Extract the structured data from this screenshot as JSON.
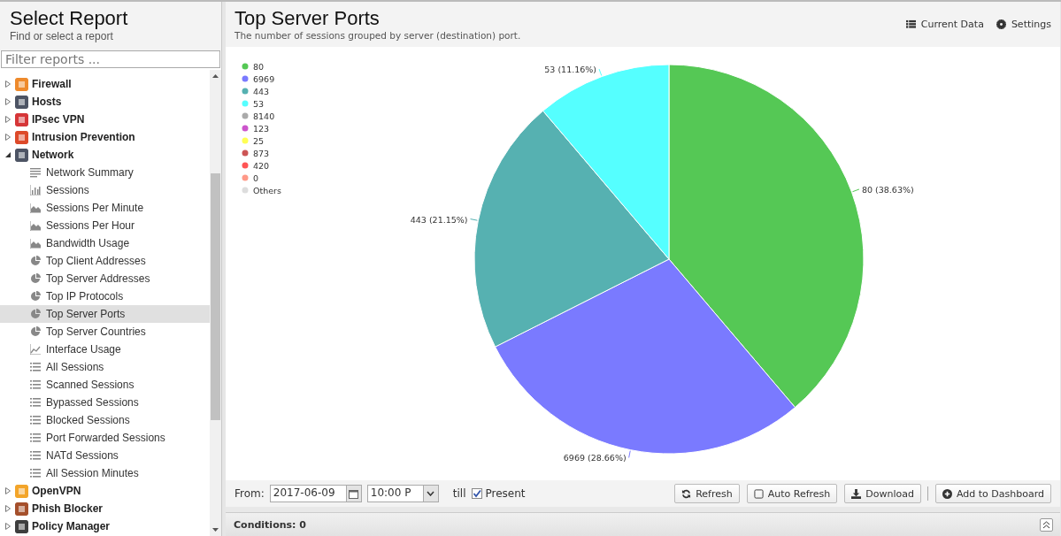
{
  "sidebar": {
    "title": "Select Report",
    "subtitle": "Find or select a report",
    "filter": {
      "placeholder": "Filter reports ..."
    },
    "items": [
      {
        "label": "Firewall",
        "color": "#ee8a2c",
        "expanded": false
      },
      {
        "label": "Hosts",
        "color": "#4d5464",
        "expanded": false
      },
      {
        "label": "IPsec VPN",
        "color": "#d63638",
        "expanded": false
      },
      {
        "label": "Intrusion Prevention",
        "color": "#dd4a2a",
        "expanded": false
      },
      {
        "label": "Network",
        "color": "#4d5464",
        "expanded": true,
        "children": [
          {
            "label": "Network Summary",
            "kind": "text",
            "selected": false
          },
          {
            "label": "Sessions",
            "kind": "bar",
            "selected": false
          },
          {
            "label": "Sessions Per Minute",
            "kind": "area",
            "selected": false
          },
          {
            "label": "Sessions Per Hour",
            "kind": "area",
            "selected": false
          },
          {
            "label": "Bandwidth Usage",
            "kind": "area",
            "selected": false
          },
          {
            "label": "Top Client Addresses",
            "kind": "pie",
            "selected": false
          },
          {
            "label": "Top Server Addresses",
            "kind": "pie",
            "selected": false
          },
          {
            "label": "Top IP Protocols",
            "kind": "pie",
            "selected": false
          },
          {
            "label": "Top Server Ports",
            "kind": "pie",
            "selected": true
          },
          {
            "label": "Top Server Countries",
            "kind": "pie",
            "selected": false
          },
          {
            "label": "Interface Usage",
            "kind": "line",
            "selected": false
          },
          {
            "label": "All Sessions",
            "kind": "list",
            "selected": false
          },
          {
            "label": "Scanned Sessions",
            "kind": "list",
            "selected": false
          },
          {
            "label": "Bypassed Sessions",
            "kind": "list",
            "selected": false
          },
          {
            "label": "Blocked Sessions",
            "kind": "list",
            "selected": false
          },
          {
            "label": "Port Forwarded Sessions",
            "kind": "list",
            "selected": false
          },
          {
            "label": "NATd Sessions",
            "kind": "list",
            "selected": false
          },
          {
            "label": "All Session Minutes",
            "kind": "list",
            "selected": false
          }
        ]
      },
      {
        "label": "OpenVPN",
        "color": "#f3a52a",
        "expanded": false
      },
      {
        "label": "Phish Blocker",
        "color": "#a5502c",
        "expanded": false
      },
      {
        "label": "Policy Manager",
        "color": "#3e3e3e",
        "expanded": false
      }
    ]
  },
  "report": {
    "title": "Top Server Ports",
    "subtitle": "The number of sessions grouped by server (destination) port.",
    "actions": [
      {
        "label": "Current Data",
        "kind": "list"
      },
      {
        "label": "Settings",
        "kind": "gear"
      }
    ],
    "chart_data": {
      "type": "pie",
      "categories": [
        "80",
        "6969",
        "443",
        "53",
        "8140",
        "123",
        "25",
        "873",
        "420",
        "0",
        "Others"
      ],
      "values": [
        38.63,
        28.66,
        21.15,
        11.16,
        null,
        null,
        null,
        null,
        null,
        null,
        null
      ],
      "legend": "left",
      "colors": [
        "#55c855",
        "#7a7aff",
        "#56b1b1",
        "#55ffff",
        "#aaaaaa",
        "#cc55cc",
        "#ffff55",
        "#cc5555",
        "#ff5555",
        "#ff9988",
        "#dddddd"
      ],
      "value_labels": [
        "80 (38.63%)",
        "6969 (28.66%)",
        "443 (21.15%)",
        "53 (11.16%)",
        null,
        null,
        null,
        null,
        null,
        null,
        null
      ]
    },
    "toolbar": {
      "from_label": "From:",
      "date": "2017-06-09",
      "time": "10:00 P",
      "till_label": "till",
      "present": {
        "label": "Present",
        "checked": true
      },
      "buttons": [
        {
          "label": "Refresh",
          "kind": "refresh"
        },
        {
          "label": "Auto Refresh",
          "kind": "toggle"
        },
        {
          "label": "Download",
          "kind": "download"
        },
        {
          "label": "Add to Dashboard",
          "kind": "add"
        }
      ]
    },
    "conditions": "Conditions: 0"
  }
}
